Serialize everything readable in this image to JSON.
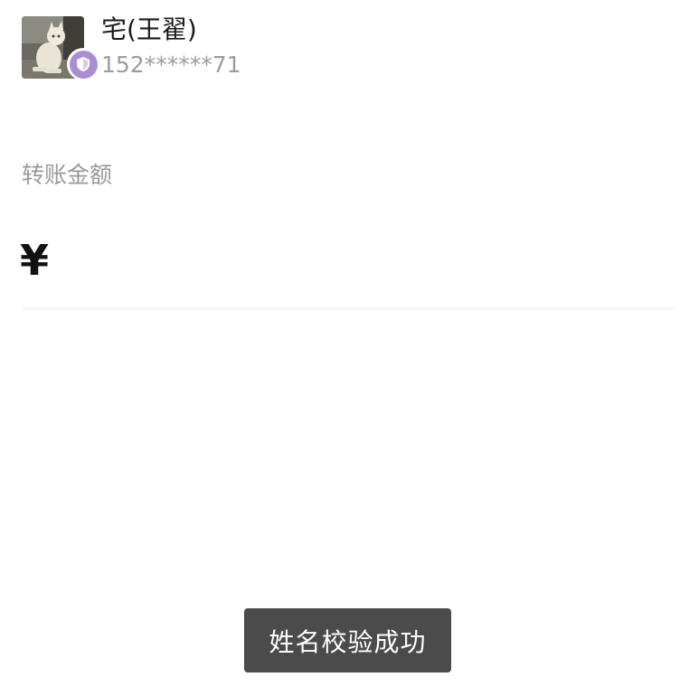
{
  "recipient": {
    "name": "宅(王翟)",
    "phone": "152******71",
    "avatar_icon": "cat-photo-avatar",
    "badge_icon": "shield-icon",
    "badge_color": "#a98ed4"
  },
  "transfer": {
    "amount_label": "转账金额",
    "currency_symbol": "¥",
    "amount_value": ""
  },
  "toast": {
    "message": "姓名校验成功",
    "background": "#4b4b4b"
  }
}
